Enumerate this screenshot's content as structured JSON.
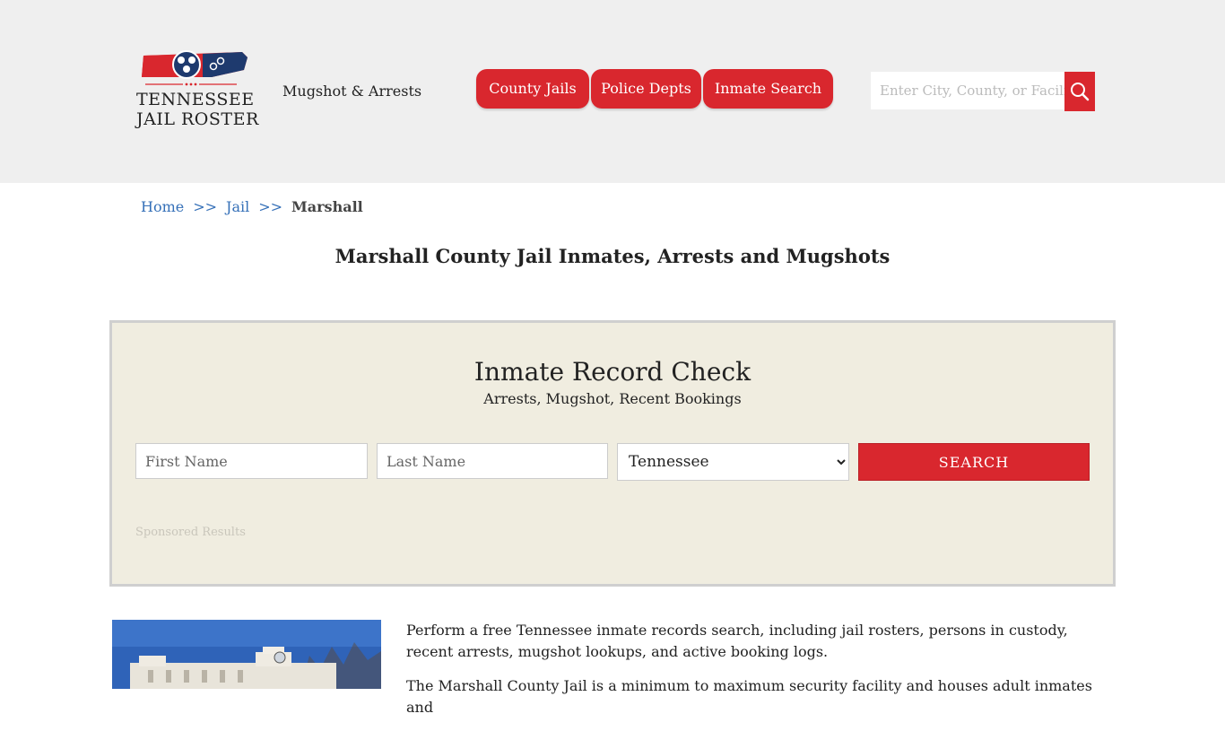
{
  "header": {
    "logo": {
      "line1": "TENNESSEE",
      "line2": "JAIL ROSTER"
    },
    "tagline": "Mugshot & Arrests",
    "nav": [
      {
        "label": "County Jails"
      },
      {
        "label": "Police Depts"
      },
      {
        "label": "Inmate Search"
      }
    ],
    "search": {
      "placeholder": "Enter City, County, or Facility",
      "icon": "search-icon"
    }
  },
  "breadcrumb": {
    "home": "Home",
    "sep": ">>",
    "jail": "Jail",
    "current": "Marshall"
  },
  "page_title": "Marshall County Jail Inmates, Arrests and Mugshots",
  "record_check": {
    "title": "Inmate Record Check",
    "subtitle": "Arrests, Mugshot, Recent Bookings",
    "first_name_placeholder": "First Name",
    "last_name_placeholder": "Last Name",
    "state_selected": "Tennessee",
    "search_label": "SEARCH",
    "sponsored": "Sponsored Results"
  },
  "intro": {
    "p1": "Perform a free Tennessee inmate records search, including jail rosters, persons in custody, recent arrests, mugshot lookups, and active booking logs.",
    "p2": "The Marshall County Jail is a minimum to maximum security facility and houses adult inmates and"
  },
  "colors": {
    "brand_red": "#d9272e",
    "header_bg": "#efefef",
    "panel_bg": "#f0ede0",
    "link_blue": "#3570b8"
  }
}
